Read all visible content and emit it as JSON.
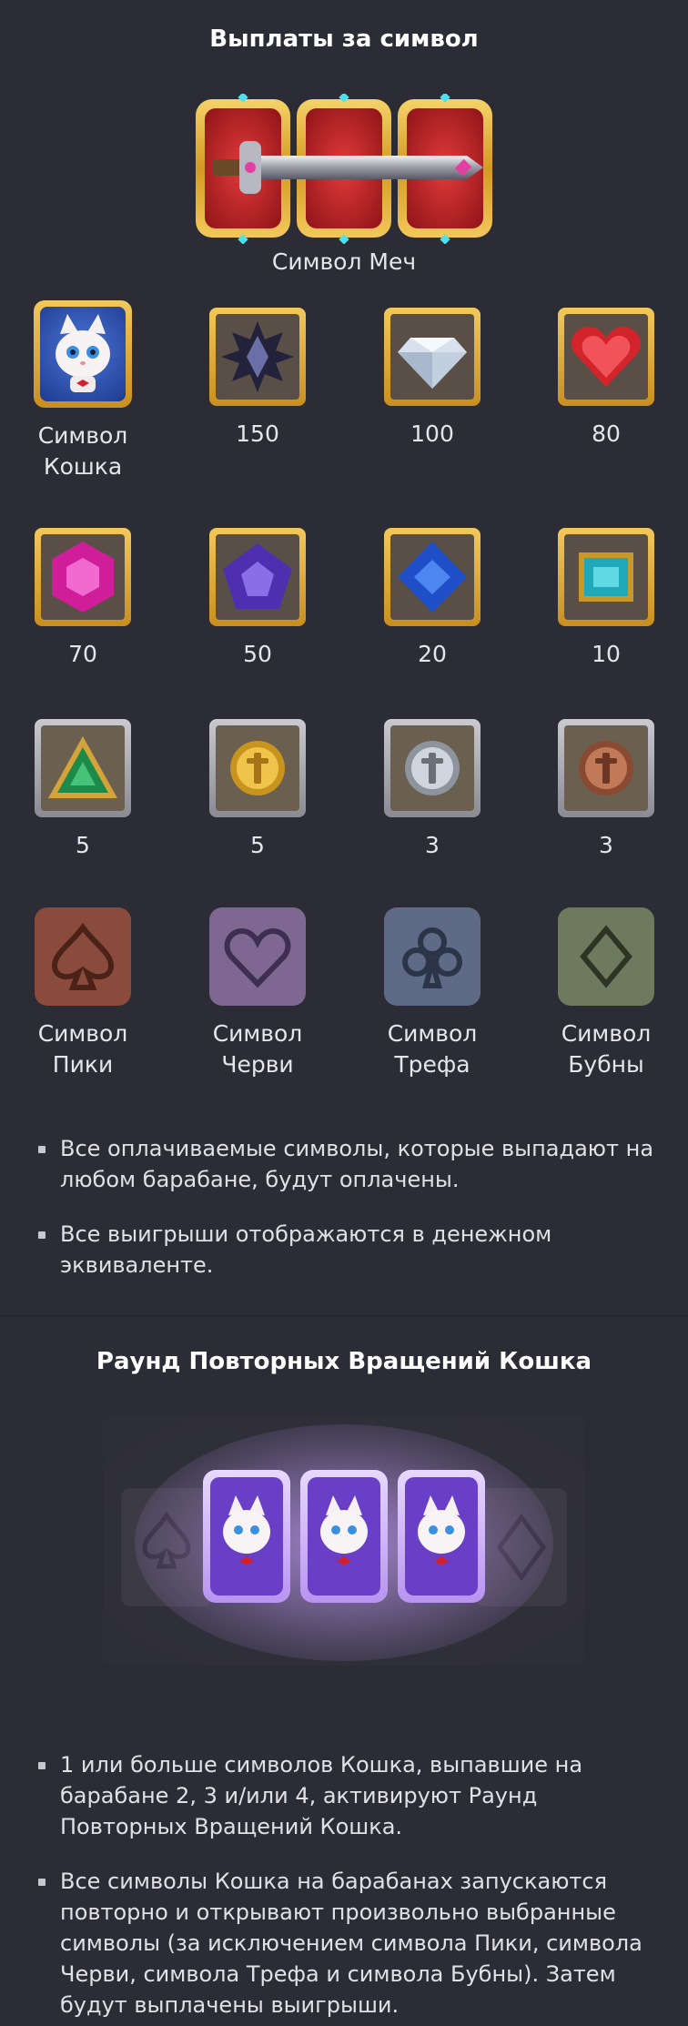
{
  "paytable": {
    "title": "Выплаты за символ",
    "sword_caption": "Символ Меч",
    "rows": [
      [
        {
          "id": "cat",
          "label": "Символ\nКошка",
          "icon": "cat-symbol-icon"
        },
        {
          "id": "black-gem",
          "label": "150",
          "icon": "black-star-gem-icon"
        },
        {
          "id": "diamond",
          "label": "100",
          "icon": "diamond-icon"
        },
        {
          "id": "heart-gem",
          "label": "80",
          "icon": "red-heart-gem-icon"
        }
      ],
      [
        {
          "id": "pink-gem",
          "label": "70",
          "icon": "pink-hexagon-gem-icon"
        },
        {
          "id": "purple-gem",
          "label": "50",
          "icon": "purple-pentagon-gem-icon"
        },
        {
          "id": "blue-gem",
          "label": "20",
          "icon": "blue-rhombus-gem-icon"
        },
        {
          "id": "teal-gem",
          "label": "10",
          "icon": "teal-square-gem-icon"
        }
      ],
      [
        {
          "id": "green-gem",
          "label": "5",
          "icon": "green-triangle-gem-icon"
        },
        {
          "id": "gold-coin",
          "label": "5",
          "icon": "gold-coin-icon"
        },
        {
          "id": "silver-coin",
          "label": "3",
          "icon": "silver-coin-icon"
        },
        {
          "id": "bronze-coin",
          "label": "3",
          "icon": "bronze-coin-icon"
        }
      ],
      [
        {
          "id": "spade",
          "label": "Символ\nПики",
          "icon": "spade-icon"
        },
        {
          "id": "heart",
          "label": "Символ\nЧерви",
          "icon": "heart-icon"
        },
        {
          "id": "club",
          "label": "Символ\nТрефа",
          "icon": "club-icon"
        },
        {
          "id": "diamond-suit",
          "label": "Символ\nБубны",
          "icon": "diamond-suit-icon"
        }
      ]
    ],
    "notes": [
      "Все оплачиваемые символы, которые выпадают на любом барабане, будут оплачены.",
      "Все выигрыши отображаются в денежном эквиваленте."
    ]
  },
  "respin": {
    "title": "Раунд Повторных Вращений Кошка",
    "notes": [
      "1 или больше символов Кошка, выпавшие на барабане 2, 3 и/или 4, активируют Раунд Повторных Вращений Кошка.",
      "Все символы Кошка на барабанах запускаются повторно и открывают произвольно выбранные символы (за исключением символа Пики, символа Черви, символа Трефа и символа Бубны). Затем будут выплачены выигрыши."
    ]
  },
  "colors": {
    "background": "#2b2c36",
    "gold_frame": "#d9a42a",
    "red_panel": "#c8282c",
    "cat_panel": "#2b4fb0"
  }
}
